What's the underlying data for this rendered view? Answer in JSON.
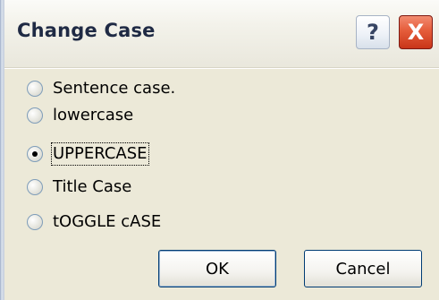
{
  "dialog": {
    "title": "Change Case",
    "help_label": "?",
    "close_label": "X"
  },
  "options": [
    {
      "label": "Sentence case."
    },
    {
      "label": "lowercase"
    },
    {
      "label": "UPPERCASE"
    },
    {
      "label": "Title Case"
    },
    {
      "label": "tOGGLE cASE"
    }
  ],
  "buttons": {
    "ok_label": "OK",
    "cancel_label": "Cancel"
  }
}
